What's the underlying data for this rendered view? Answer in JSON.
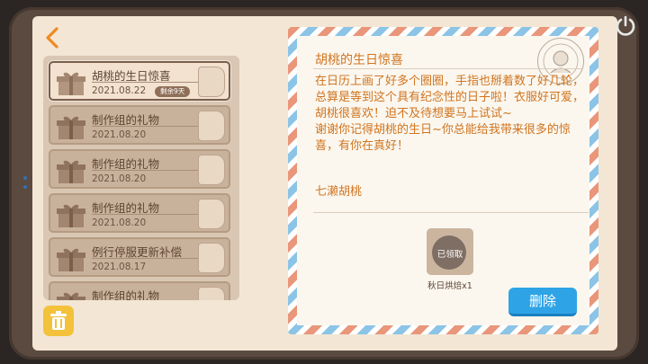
{
  "mail_list": [
    {
      "title": "胡桃的生日惊喜",
      "date": "2021.08.22",
      "badge": "剩余9天",
      "active": true
    },
    {
      "title": "制作组的礼物",
      "date": "2021.08.20",
      "badge": "",
      "active": false
    },
    {
      "title": "制作组的礼物",
      "date": "2021.08.20",
      "badge": "",
      "active": false
    },
    {
      "title": "制作组的礼物",
      "date": "2021.08.20",
      "badge": "",
      "active": false
    },
    {
      "title": "例行停服更新补偿",
      "date": "2021.08.17",
      "badge": "",
      "active": false
    },
    {
      "title": "制作组的礼物",
      "date": "",
      "badge": "",
      "active": false
    }
  ],
  "letter": {
    "title": "胡桃的生日惊喜",
    "body": "在日历上画了好多个圈圈，手指也掰着数了好几轮，总算是等到这个具有纪念性的日子啦！衣服好可爱，胡桃很喜欢！迫不及待想要马上试试~\n谢谢你记得胡桃的生日~你总能给我带来很多的惊喜，有你在真好！",
    "signature": "七濑胡桃",
    "attachment": {
      "status": "已领取",
      "label": "秋日烘焙x1"
    },
    "delete_label": "删除"
  },
  "icons": {
    "back": "chevron-left-icon",
    "power": "power-icon",
    "trash": "trash-icon",
    "gift": "gift-icon"
  },
  "colors": {
    "accent_orange": "#d0741f",
    "delete_blue": "#2ea4e6",
    "trash_yellow": "#f3c23a"
  }
}
